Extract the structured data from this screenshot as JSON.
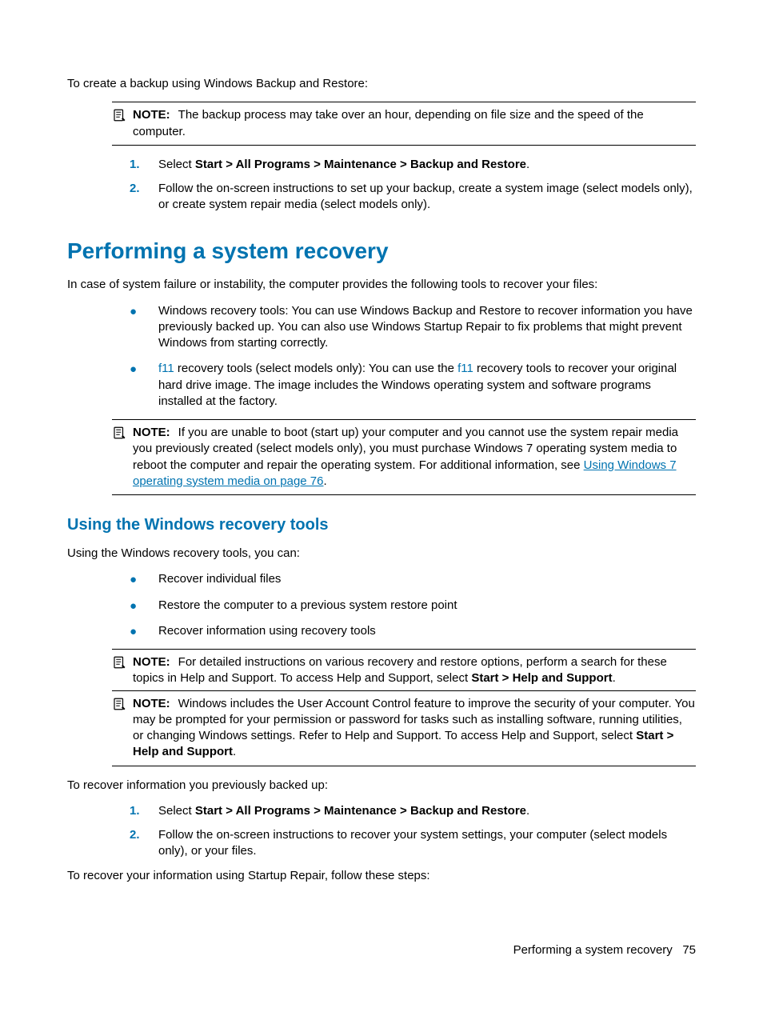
{
  "intro": "To create a backup using Windows Backup and Restore:",
  "note1": {
    "label": "NOTE:",
    "text": "The backup process may take over an hour, depending on file size and the speed of the computer."
  },
  "steps1": {
    "n1": "1.",
    "n2": "2.",
    "s1_pre": "Select ",
    "s1_bold": "Start > All Programs > Maintenance > Backup and Restore",
    "s1_post": ".",
    "s2": "Follow the on-screen instructions to set up your backup, create a system image (select models only), or create system repair media (select models only)."
  },
  "h1": "Performing a system recovery",
  "h1_intro": "In case of system failure or instability, the computer provides the following tools to recover your files:",
  "bul1": {
    "b1": "Windows recovery tools: You can use Windows Backup and Restore to recover information you have previously backed up. You can also use Windows Startup Repair to fix problems that might prevent Windows from starting correctly.",
    "b2_f11a": "f11",
    "b2_mid1": " recovery tools (select models only): You can use the ",
    "b2_f11b": "f11",
    "b2_mid2": " recovery tools to recover your original hard drive image. The image includes the Windows operating system and software programs installed at the factory."
  },
  "note2": {
    "label": "NOTE:",
    "pre": "If you are unable to boot (start up) your computer and you cannot use the system repair media you previously created (select models only), you must purchase Windows 7 operating system media to reboot the computer and repair the operating system. For additional information, see ",
    "link": "Using Windows 7 operating system media on page 76",
    "post": "."
  },
  "h2": "Using the Windows recovery tools",
  "h2_intro": "Using the Windows recovery tools, you can:",
  "bul2": {
    "b1": "Recover individual files",
    "b2": "Restore the computer to a previous system restore point",
    "b3": "Recover information using recovery tools"
  },
  "note3": {
    "label": "NOTE:",
    "pre": "For detailed instructions on various recovery and restore options, perform a search for these topics in Help and Support. To access Help and Support, select ",
    "bold": "Start > Help and Support",
    "post": "."
  },
  "note4": {
    "label": "NOTE:",
    "pre": "Windows includes the User Account Control feature to improve the security of your computer. You may be prompted for your permission or password for tasks such as installing software, running utilities, or changing Windows settings. Refer to Help and Support. To access Help and Support, select ",
    "bold": "Start > Help and Support",
    "post": "."
  },
  "recover_intro": "To recover information you previously backed up:",
  "steps2": {
    "n1": "1.",
    "n2": "2.",
    "s1_pre": "Select ",
    "s1_bold": "Start > All Programs > Maintenance > Backup and Restore",
    "s1_post": ".",
    "s2": "Follow the on-screen instructions to recover your system settings, your computer (select models only), or your files."
  },
  "startup_line": "To recover your information using Startup Repair, follow these steps:",
  "footer": {
    "text": "Performing a system recovery",
    "page": "75"
  }
}
